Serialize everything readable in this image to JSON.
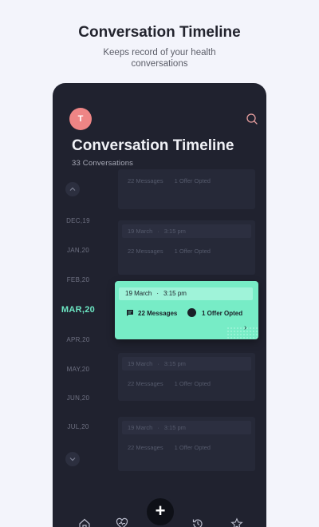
{
  "promo": {
    "title": "Conversation Timeline",
    "subtitle": "Keeps record of your health conversations"
  },
  "header": {
    "avatar_initial": "T",
    "title": "Conversation Timeline",
    "count": "33 Conversations"
  },
  "months": [
    "DEC,19",
    "JAN,20",
    "FEB,20",
    "MAR,20",
    "APR,20",
    "MAY,20",
    "JUN,20",
    "JUL,20"
  ],
  "active_month": "MAR,20",
  "cards": [
    {
      "date": "19 March",
      "time": "3:15 pm",
      "messages": "22 Messages",
      "offers": "1 Offer Opted"
    },
    {
      "date": "19 March",
      "time": "3:15 pm",
      "messages": "22 Messages",
      "offers": "1 Offer Opted"
    },
    {
      "date": "19 March",
      "time": "3:15 pm",
      "messages": "22 Messages",
      "offers": "1 Offer Opted"
    },
    {
      "date": "19 March",
      "time": "3:15 pm",
      "messages": "22 Messages",
      "offers": "1 Offer Opted"
    },
    {
      "date": "19 March",
      "time": "3:15 pm",
      "messages": "22 Messages",
      "offers": "1 Offer Opted"
    }
  ],
  "colors": {
    "accent": "#77ecc6",
    "background": "#20222f",
    "avatar": "#ee8585"
  },
  "nav": {
    "items": [
      "home-icon",
      "heart-icon",
      "plus-icon",
      "history-icon",
      "star-icon"
    ],
    "fab_label": "+"
  }
}
